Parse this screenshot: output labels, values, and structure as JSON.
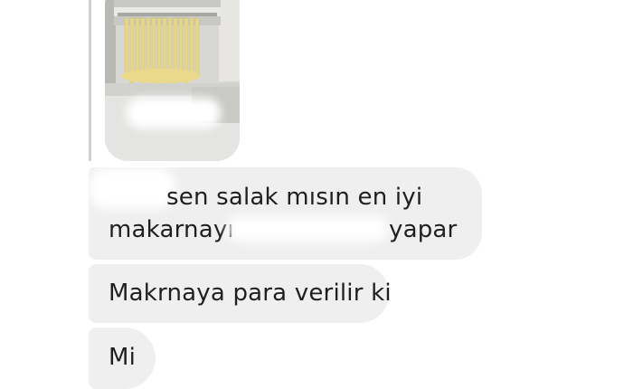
{
  "messages": [
    {
      "line1": "sen salak mısın en iyi",
      "line2_start": "makarnayı",
      "line2_end": "yapar"
    },
    {
      "text": "Makrnaya para verilir ki"
    },
    {
      "text": "Mi"
    }
  ],
  "colors": {
    "bubble_bg": "#efefef",
    "text": "#1f1f1f",
    "reply_bar": "#cfcfcf",
    "page_bg": "#ffffff"
  }
}
